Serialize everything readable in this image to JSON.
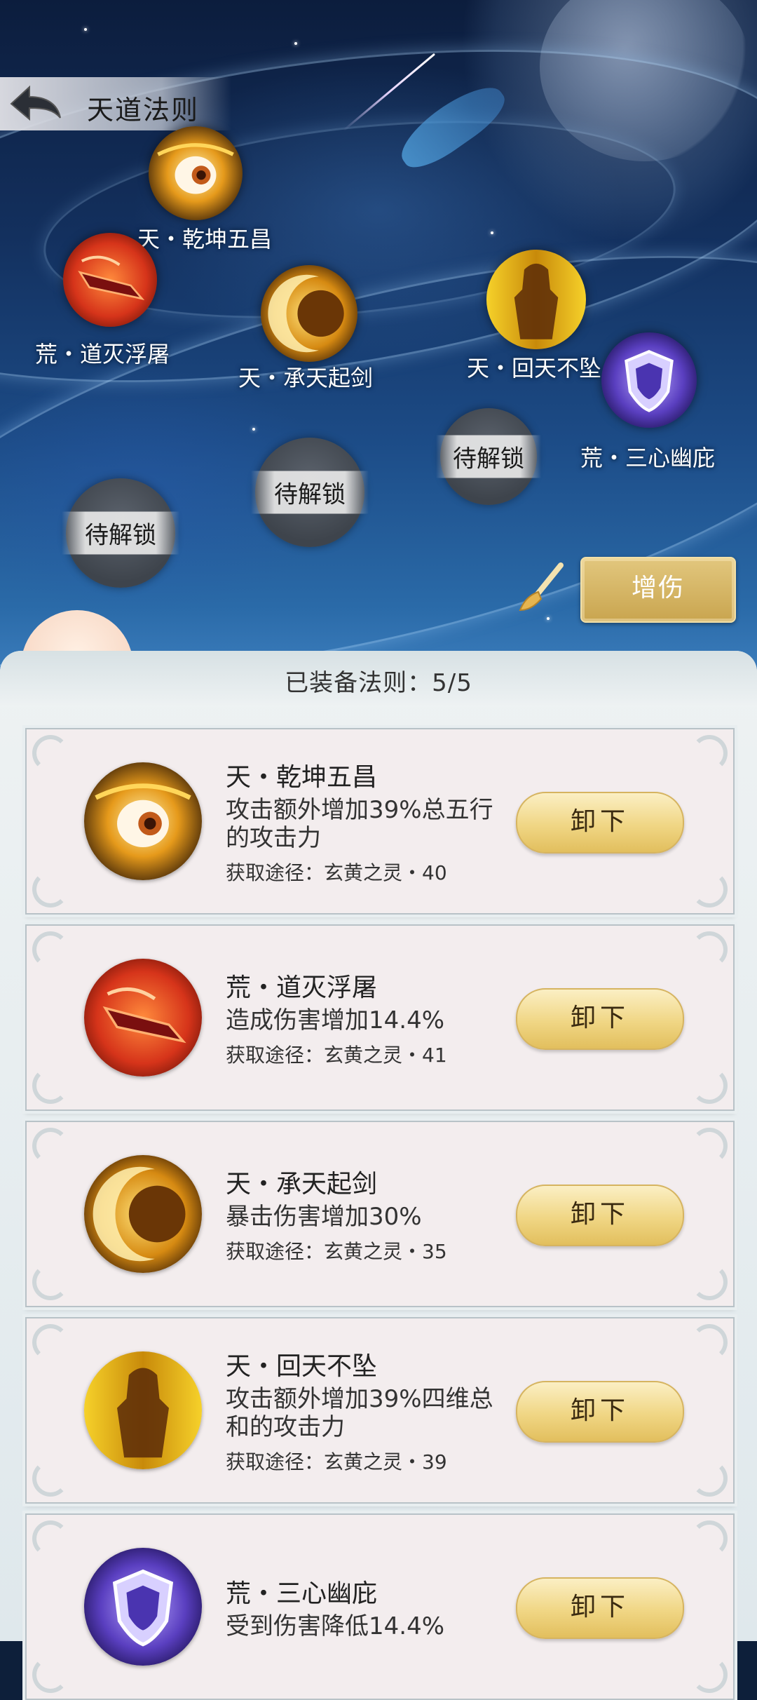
{
  "header": {
    "title": "天道法则"
  },
  "nodes": [
    {
      "name": "天・乾坤五昌",
      "icon": "eye-of-flame-icon"
    },
    {
      "name": "荒・道灭浮屠",
      "icon": "red-blade-icon"
    },
    {
      "name": "天・承天起剑",
      "icon": "golden-crescent-icon"
    },
    {
      "name": "天・回天不坠",
      "icon": "golden-warrior-icon"
    },
    {
      "name": "荒・三心幽庇",
      "icon": "purple-shield-icon"
    }
  ],
  "locked_label": "待解锁",
  "buff_button": "增伤",
  "panel": {
    "equipped_title": "已装备法则：5/5",
    "unequip_label": "卸下",
    "cards": [
      {
        "name": "天・乾坤五昌",
        "desc": "攻击额外增加39%总五行的攻击力",
        "source": "获取途径：玄黄之灵・40"
      },
      {
        "name": "荒・道灭浮屠",
        "desc": "造成伤害增加14.4%",
        "source": "获取途径：玄黄之灵・41"
      },
      {
        "name": "天・承天起剑",
        "desc": "暴击伤害增加30%",
        "source": "获取途径：玄黄之灵・35"
      },
      {
        "name": "天・回天不坠",
        "desc": "攻击额外增加39%四维总和的攻击力",
        "source": "获取途径：玄黄之灵・39"
      },
      {
        "name": "荒・三心幽庇",
        "desc": "受到伤害降低14.4%",
        "source": ""
      }
    ]
  },
  "colors": {
    "button_gold": "#f0d684",
    "panel_bg": "#eef2f3",
    "sky_dark": "#0c1d3d"
  }
}
